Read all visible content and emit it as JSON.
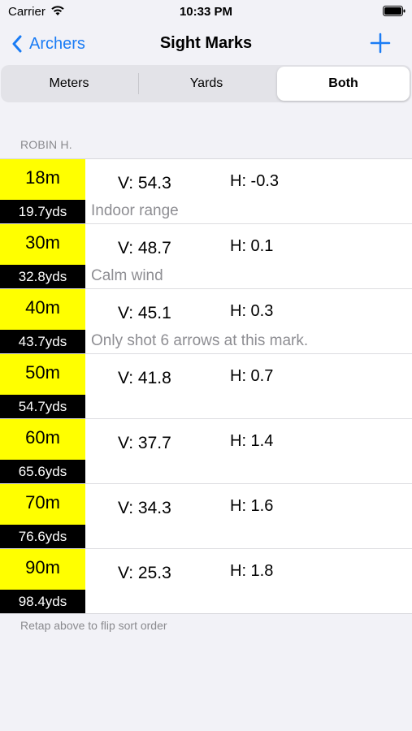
{
  "status_bar": {
    "carrier": "Carrier",
    "time": "10:33 PM"
  },
  "nav": {
    "back_label": "Archers",
    "title": "Sight Marks"
  },
  "segments": {
    "meters": "Meters",
    "yards": "Yards",
    "both": "Both",
    "selected": "Both"
  },
  "section_header": "ROBIN H.",
  "marks": [
    {
      "meters": "18m",
      "yards": "19.7yds",
      "v": "V: 54.3",
      "h": "H: -0.3",
      "note": "Indoor range"
    },
    {
      "meters": "30m",
      "yards": "32.8yds",
      "v": "V: 48.7",
      "h": "H: 0.1",
      "note": "Calm wind"
    },
    {
      "meters": "40m",
      "yards": "43.7yds",
      "v": "V: 45.1",
      "h": "H: 0.3",
      "note": "Only shot 6 arrows at this mark."
    },
    {
      "meters": "50m",
      "yards": "54.7yds",
      "v": "V: 41.8",
      "h": "H: 0.7",
      "note": ""
    },
    {
      "meters": "60m",
      "yards": "65.6yds",
      "v": "V: 37.7",
      "h": "H: 1.4",
      "note": ""
    },
    {
      "meters": "70m",
      "yards": "76.6yds",
      "v": "V: 34.3",
      "h": "H: 1.6",
      "note": ""
    },
    {
      "meters": "90m",
      "yards": "98.4yds",
      "v": "V: 25.3",
      "h": "H: 1.8",
      "note": ""
    }
  ],
  "footer_note": "Retap above to flip sort order",
  "colors": {
    "accent": "#1a7cf5",
    "meters_badge": "#ffff00",
    "yards_badge": "#000000"
  },
  "icons": {
    "wifi": "wifi-icon",
    "battery": "battery-icon",
    "back": "chevron-left-icon",
    "add": "plus-icon"
  }
}
